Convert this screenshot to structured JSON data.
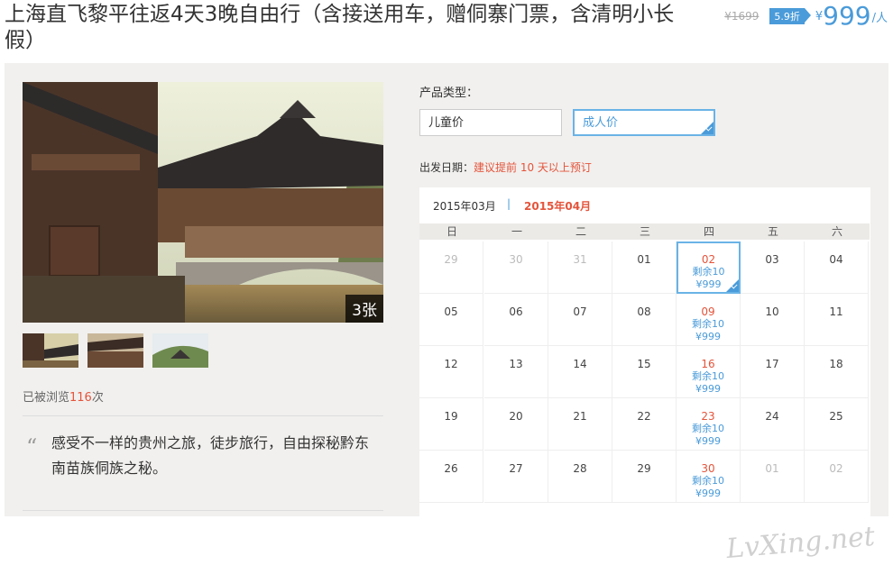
{
  "title": "上海直飞黎平往返4天3晚自由行（含接送用车，赠侗寨门票，含清明小长假）",
  "pricing": {
    "original": "¥1699",
    "discount": "5.9折",
    "currency": "¥",
    "price": "999",
    "unit": "/人"
  },
  "gallery": {
    "count_label": "3张",
    "thumbnails": 3
  },
  "views": {
    "prefix": "已被浏览",
    "count": "116",
    "suffix": "次"
  },
  "description": "感受不一样的贵州之旅，徒步旅行，自由探秘黔东南苗族侗族之秘。",
  "product": {
    "type_label": "产品类型：",
    "options": [
      {
        "label": "儿童价",
        "selected": false
      },
      {
        "label": "成人价",
        "selected": true
      }
    ]
  },
  "departure": {
    "label": "出发日期：",
    "hint": "建议提前 10 天以上预订"
  },
  "calendar": {
    "prev_month": "2015年03月",
    "separator": "|",
    "current_month": "2015年04月",
    "weekdays": [
      "日",
      "一",
      "二",
      "三",
      "四",
      "五",
      "六"
    ],
    "weeks": [
      [
        {
          "d": "29",
          "dim": true
        },
        {
          "d": "30",
          "dim": true
        },
        {
          "d": "31",
          "dim": true
        },
        {
          "d": "01"
        },
        {
          "d": "02",
          "avail": true,
          "sel": true,
          "remain": "剩余10",
          "price": "¥999"
        },
        {
          "d": "03"
        },
        {
          "d": "04"
        }
      ],
      [
        {
          "d": "05"
        },
        {
          "d": "06"
        },
        {
          "d": "07"
        },
        {
          "d": "08"
        },
        {
          "d": "09",
          "avail": true,
          "remain": "剩余10",
          "price": "¥999"
        },
        {
          "d": "10"
        },
        {
          "d": "11"
        }
      ],
      [
        {
          "d": "12"
        },
        {
          "d": "13"
        },
        {
          "d": "14"
        },
        {
          "d": "15"
        },
        {
          "d": "16",
          "avail": true,
          "remain": "剩余10",
          "price": "¥999"
        },
        {
          "d": "17"
        },
        {
          "d": "18"
        }
      ],
      [
        {
          "d": "19"
        },
        {
          "d": "20"
        },
        {
          "d": "21"
        },
        {
          "d": "22"
        },
        {
          "d": "23",
          "avail": true,
          "remain": "剩余10",
          "price": "¥999"
        },
        {
          "d": "24"
        },
        {
          "d": "25"
        }
      ],
      [
        {
          "d": "26"
        },
        {
          "d": "27"
        },
        {
          "d": "28"
        },
        {
          "d": "29"
        },
        {
          "d": "30",
          "avail": true,
          "remain": "剩余10",
          "price": "¥999"
        },
        {
          "d": "01",
          "dim": true
        },
        {
          "d": "02",
          "dim": true
        }
      ]
    ]
  },
  "watermark": "LvXing.net"
}
